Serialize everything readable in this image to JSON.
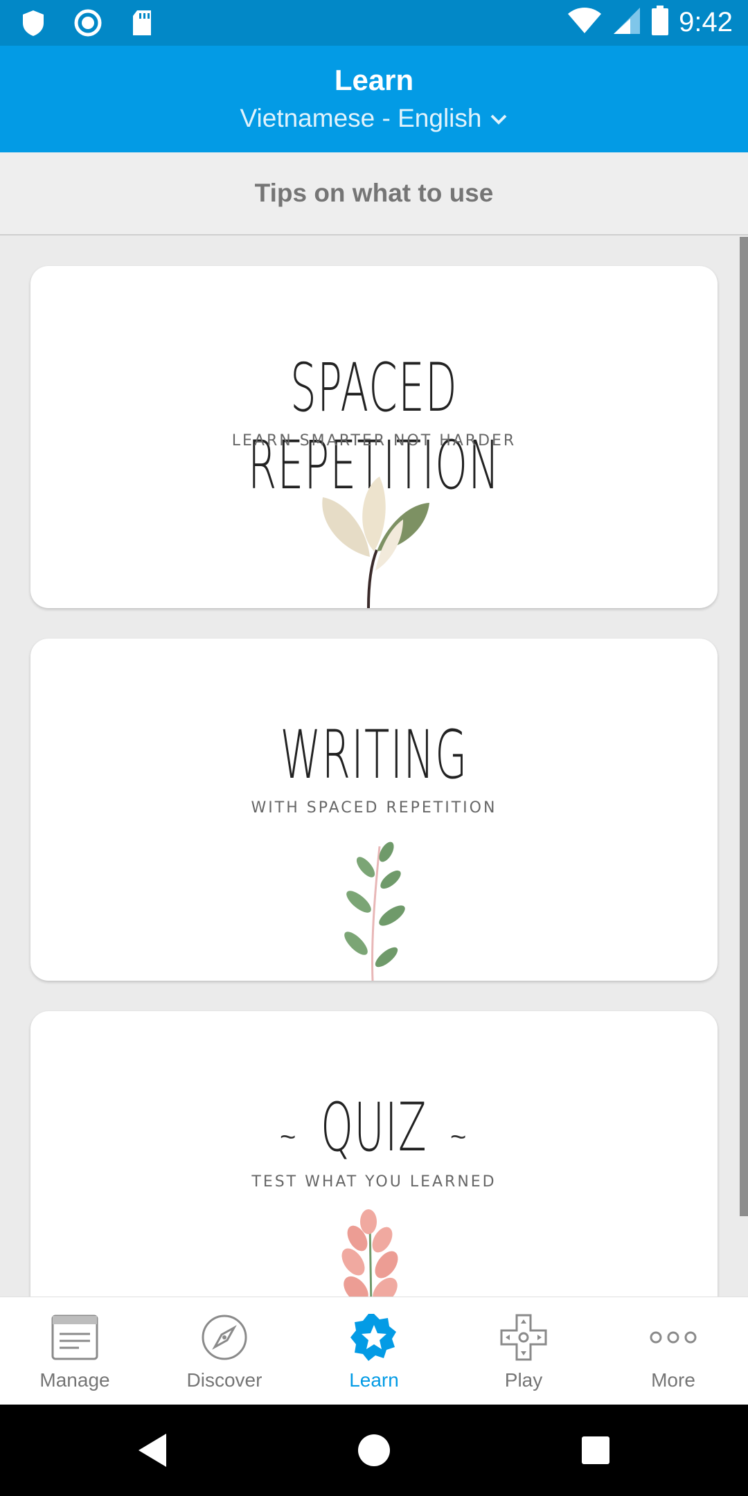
{
  "status_bar": {
    "time": "9:42",
    "left_icons": [
      "shield-icon",
      "circle-sync-icon",
      "sd-card-icon"
    ],
    "right_icons": [
      "wifi-icon",
      "signal-icon",
      "battery-icon"
    ]
  },
  "header": {
    "title": "Learn",
    "language_pair": "Vietnamese - English",
    "dropdown_icon": "chevron-down-icon"
  },
  "tips": {
    "label": "Tips on what to use"
  },
  "cards": [
    {
      "title": "SPACED REPETITION",
      "subtitle": "LEARN SMARTER NOT HARDER",
      "illustration": "leaf-branch-icon"
    },
    {
      "title": "WRITING",
      "subtitle": "WITH SPACED REPETITION",
      "illustration": "green-sprig-icon"
    },
    {
      "title": "QUIZ",
      "subtitle": "TEST WHAT YOU LEARNED",
      "illustration": "pink-flower-icon",
      "title_decoration": "~"
    }
  ],
  "bottom_nav": {
    "active": "Learn",
    "items": [
      {
        "label": "Manage",
        "icon": "document-icon"
      },
      {
        "label": "Discover",
        "icon": "compass-icon"
      },
      {
        "label": "Learn",
        "icon": "star-badge-icon"
      },
      {
        "label": "Play",
        "icon": "gamepad-icon"
      },
      {
        "label": "More",
        "icon": "more-dots-icon"
      }
    ]
  },
  "system_nav": {
    "buttons": [
      "back-icon",
      "home-icon",
      "recents-icon"
    ]
  },
  "colors": {
    "status_bar": "#0288c7",
    "app_bar": "#039be5",
    "accent": "#039be5",
    "background": "#ebebeb",
    "tips_bar": "#eeeeee"
  }
}
